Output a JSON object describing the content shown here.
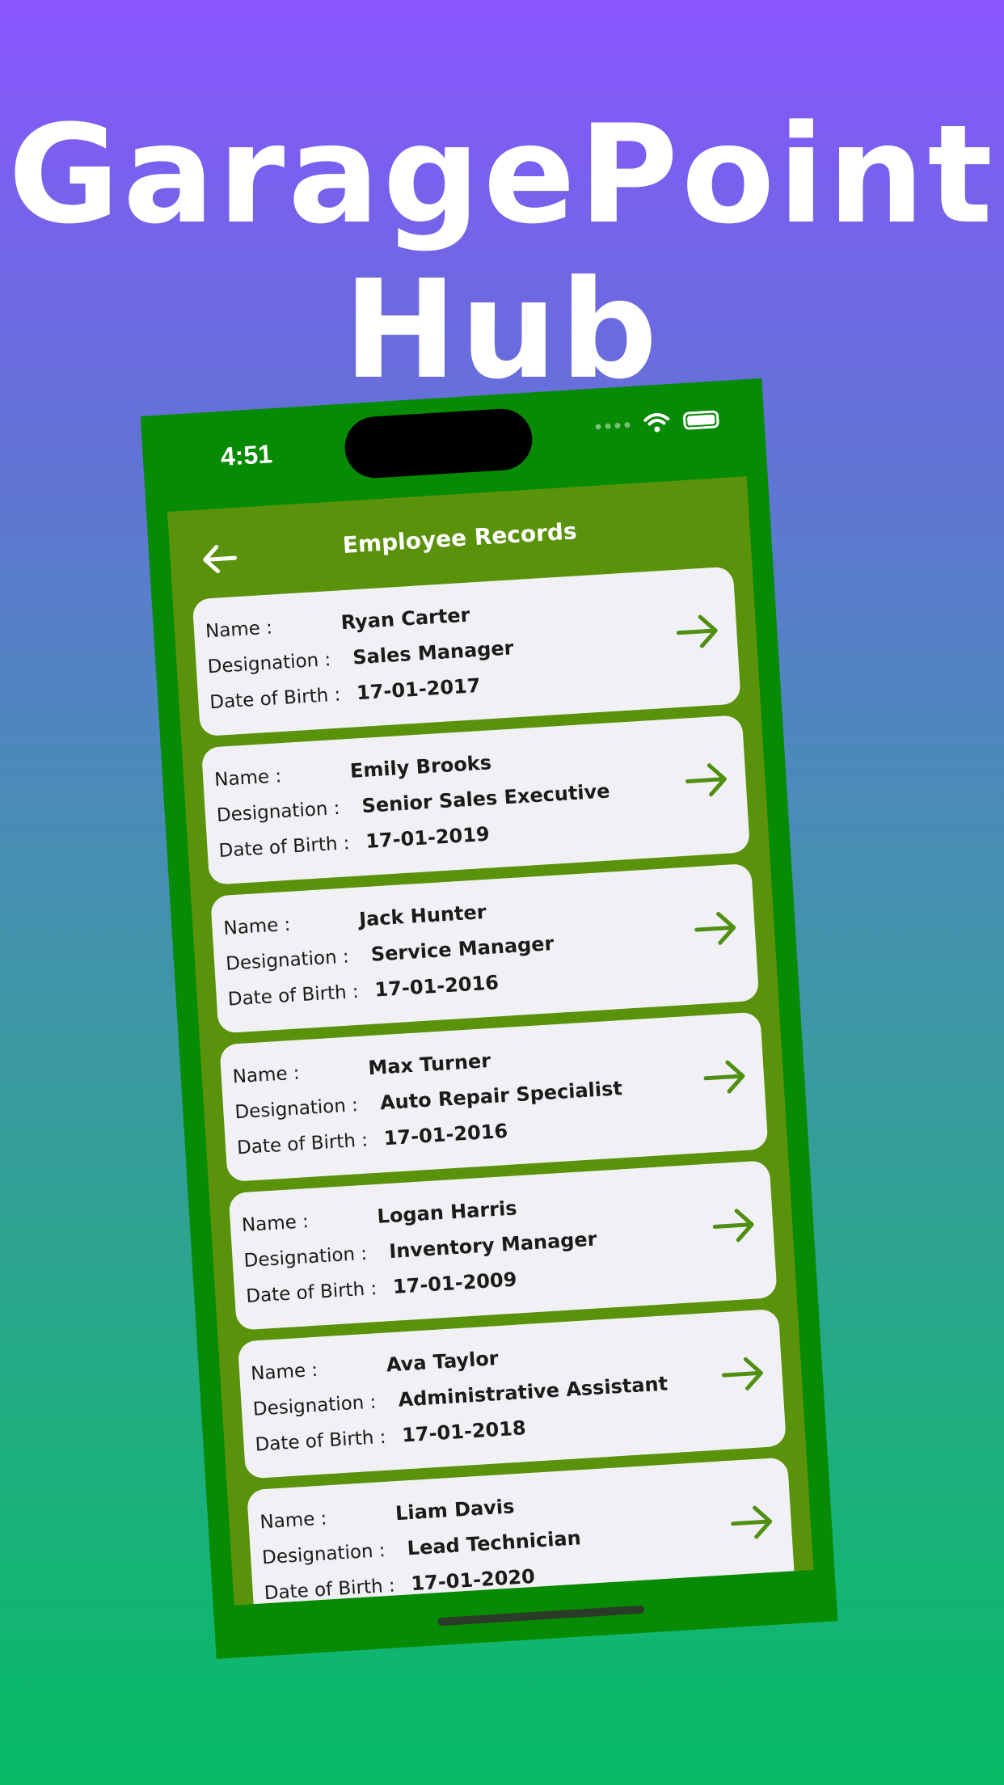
{
  "headline": {
    "line1": "GaragePoint",
    "line2": "Hub"
  },
  "status_bar": {
    "time": "4:51",
    "icons": [
      "signal-icon",
      "wifi-icon",
      "battery-icon"
    ]
  },
  "nav": {
    "title": "Employee Records",
    "back_icon": "arrow-left-icon"
  },
  "labels": {
    "name": "Name :",
    "designation": "Designation :",
    "dob": "Date of Birth :"
  },
  "employees": [
    {
      "name": "Ryan Carter",
      "designation": "Sales Manager",
      "dob": "17-01-2017"
    },
    {
      "name": "Emily Brooks",
      "designation": "Senior Sales Executive",
      "dob": "17-01-2019"
    },
    {
      "name": "Jack Hunter",
      "designation": "Service Manager",
      "dob": "17-01-2016"
    },
    {
      "name": "Max Turner",
      "designation": "Auto Repair Specialist",
      "dob": "17-01-2016"
    },
    {
      "name": "Logan Harris",
      "designation": "Inventory Manager",
      "dob": "17-01-2009"
    },
    {
      "name": "Ava Taylor",
      "designation": "Administrative Assistant",
      "dob": "17-01-2018"
    },
    {
      "name": "Liam Davis",
      "designation": "Lead Technician",
      "dob": "17-01-2020"
    }
  ],
  "colors": {
    "phone_frame": "#078a04",
    "screen_bg": "#5b920b",
    "card_bg": "#f1f1f5",
    "arrow": "#4f8f12",
    "text": "#1b1b1b"
  }
}
